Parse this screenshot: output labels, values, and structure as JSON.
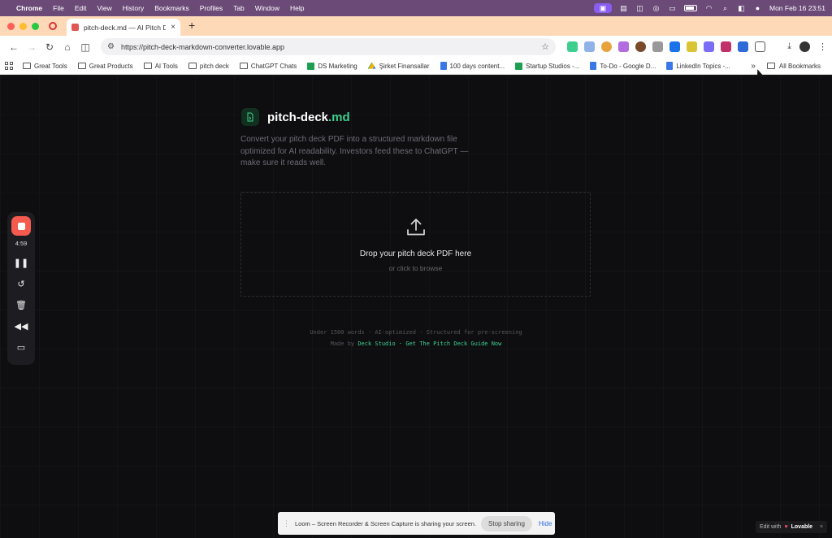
{
  "menubar": {
    "app": "Chrome",
    "items": [
      "File",
      "Edit",
      "View",
      "History",
      "Bookmarks",
      "Profiles",
      "Tab",
      "Window",
      "Help"
    ],
    "clock": "Mon Feb 16  23:51"
  },
  "tab": {
    "title": "pitch-deck.md — AI Pitch De",
    "close": "×",
    "new_tab": "+"
  },
  "toolbar": {
    "url": "https://pitch-deck-markdown-converter.lovable.app"
  },
  "bookmarks": [
    {
      "label": "Great Tools",
      "icon": "folder"
    },
    {
      "label": "Great Products",
      "icon": "folder"
    },
    {
      "label": "AI Tools",
      "icon": "folder"
    },
    {
      "label": "pitch deck",
      "icon": "folder"
    },
    {
      "label": "ChatGPT Chats",
      "icon": "folder"
    },
    {
      "label": "DS Marketing",
      "icon": "sheet"
    },
    {
      "label": "Şirket Finansallar",
      "icon": "drive"
    },
    {
      "label": "100 days content...",
      "icon": "doc"
    },
    {
      "label": "Startup Studios -...",
      "icon": "sheet"
    },
    {
      "label": "To-Do - Google D...",
      "icon": "doc"
    },
    {
      "label": "LinkedIn Topics -...",
      "icon": "doc"
    }
  ],
  "bookmarks_more": "»",
  "bookmarks_all": "All Bookmarks",
  "page": {
    "logo_name": "pitch-deck",
    "logo_ext": ".md",
    "tagline": "Convert your pitch deck PDF into a structured markdown file optimized for AI readability. Investors feed these to ChatGPT — make sure it reads well.",
    "drop_title": "Drop your pitch deck PDF here",
    "drop_sub": "or click to browse",
    "meta": "Under 1500 words · AI-optimized · Structured for pre-screening",
    "made_by_prefix": "Made by ",
    "made_by_link": "Deck Studio",
    "separator": " · ",
    "guide_link": "Get The Pitch Deck Guide Now",
    "accent": "#3ecf8e"
  },
  "loom": {
    "timer": "4:59",
    "share_text": "Loom – Screen Recorder & Screen Capture is sharing your screen.",
    "stop": "Stop sharing",
    "hide": "Hide"
  },
  "lovable": {
    "prefix": "Edit with",
    "brand": "Lovable",
    "close": "×"
  }
}
